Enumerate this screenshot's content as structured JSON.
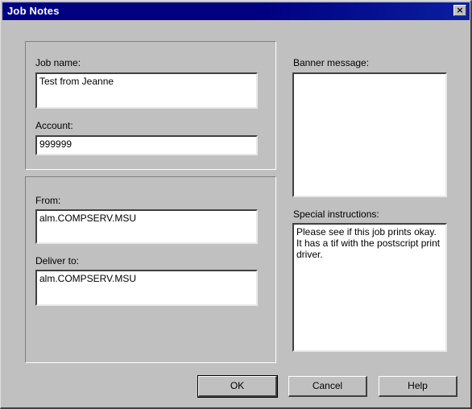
{
  "window": {
    "title": "Job Notes",
    "close_glyph": "×"
  },
  "fields": {
    "job_name": {
      "label": "Job name:",
      "value": "Test from Jeanne"
    },
    "account": {
      "label": "Account:",
      "value": "999999"
    },
    "from": {
      "label": "From:",
      "value": "alm.COMPSERV.MSU"
    },
    "deliver_to": {
      "label": "Deliver to:",
      "value": "alm.COMPSERV.MSU"
    },
    "banner_message": {
      "label": "Banner message:",
      "value": ""
    },
    "special_instructions": {
      "label": "Special instructions:",
      "value": "Please see if this job prints okay. It has a tif with the postscript print driver."
    }
  },
  "buttons": {
    "ok": "OK",
    "cancel": "Cancel",
    "help": "Help"
  },
  "colors": {
    "titlebar": "#000080",
    "face": "#c0c0c0"
  }
}
